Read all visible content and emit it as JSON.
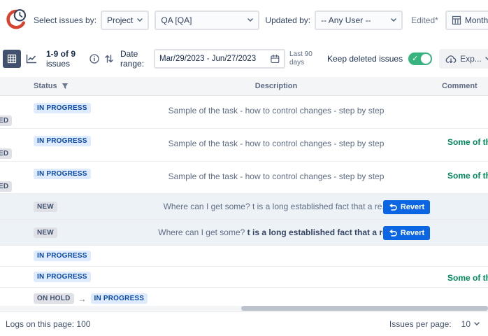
{
  "colors": {
    "accent_blue": "#0C66E4",
    "badge_blue_bg": "#DEEBFF",
    "badge_blue_text": "#0747A6",
    "badge_gray_bg": "#DFE1E6",
    "badge_gray_text": "#42526E",
    "comment_green": "#00875A",
    "toggle_on_green": "#36B37E",
    "selected_button_bg": "#42526E",
    "highlight_row_bg": "#EDF2F7"
  },
  "icons": {
    "check": "✓",
    "arrow_right": "→"
  },
  "topbar": {
    "select_issues_label": "Select issues by:",
    "select_by": "Project",
    "project": "QA [QA]",
    "updated_by_label": "Updated by:",
    "updated_by": "-- Any User --",
    "edited_label": "Edited*",
    "view_mode": "Monthly"
  },
  "toolbar": {
    "issues_count": "1-9 of 9",
    "issues_count_suffix": "issues",
    "date_range_label": "Date range:",
    "date_range_value": "Mar/29/2023 - Jun/27/2023",
    "quick_range": "Last 90 days",
    "keep_deleted_label": "Keep deleted issues",
    "export_label": "Exp..."
  },
  "table": {
    "headers": {
      "status": "Status",
      "description": "Description",
      "comment": "Comment"
    },
    "rows": [
      {
        "status": "IN PROGRESS",
        "left_fragment": "ED",
        "description": "Sample of the task - how to control changes - step by step"
      },
      {
        "status": "IN PROGRESS",
        "left_fragment": "ED",
        "description": "Sample of the task - how to control changes - step by step",
        "comment": "Some of the..."
      },
      {
        "status": "IN PROGRESS",
        "left_fragment": "ED",
        "description": "Sample of the task - how to control changes - step by step",
        "comment": "Some of the..."
      },
      {
        "status": "NEW",
        "description": "Where can I get some? t is a long established fact that a re...",
        "revert_label": "Revert"
      },
      {
        "status": "NEW",
        "description_prefix": "Where can I get some? ",
        "description_bold": "t is a long established fact that a re...",
        "revert_label": "Revert"
      },
      {
        "status": "IN PROGRESS"
      },
      {
        "status": "IN PROGRESS",
        "comment": "Some of the..."
      },
      {
        "status_from": "ON HOLD",
        "status": "IN PROGRESS"
      }
    ]
  },
  "footer": {
    "logs_label": "Logs on this page: 100",
    "per_page_label": "Issues per page:",
    "per_page_value": "10"
  }
}
